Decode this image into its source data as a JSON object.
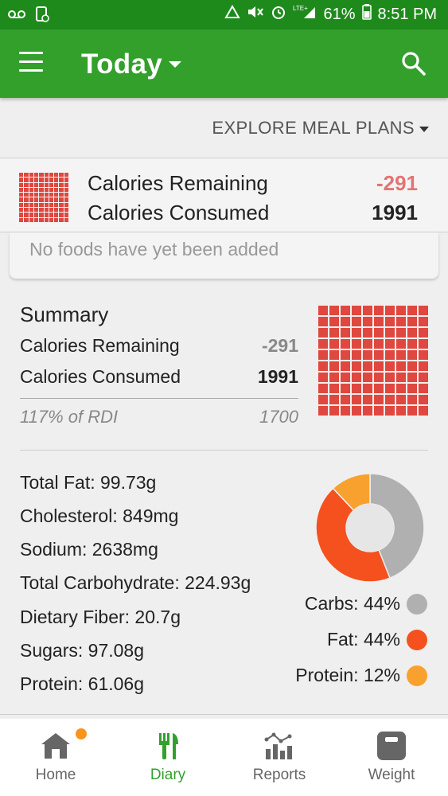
{
  "status_bar": {
    "battery": "61%",
    "time": "8:51 PM",
    "network": "LTE+"
  },
  "app_bar": {
    "title": "Today"
  },
  "explore": {
    "label": "EXPLORE MEAL PLANS"
  },
  "calorie_card": {
    "remaining_label": "Calories Remaining",
    "remaining_value": "-291",
    "consumed_label": "Calories Consumed",
    "consumed_value": "1991",
    "empty_message": "No foods have yet been added"
  },
  "summary": {
    "title": "Summary",
    "remaining_label": "Calories Remaining",
    "remaining_value": "-291",
    "consumed_label": "Calories Consumed",
    "consumed_value": "1991",
    "rdi_label": "117% of RDI",
    "rdi_value": "1700"
  },
  "nutrients": [
    "Total Fat: 99.73g",
    "Cholesterol: 849mg",
    "Sodium: 2638mg",
    "Total Carbohydrate: 224.93g",
    "Dietary Fiber: 20.7g",
    "Sugars: 97.08g",
    "Protein: 61.06g"
  ],
  "macros": {
    "legend": [
      {
        "label": "Carbs: 44%",
        "color": "#b0b0b0"
      },
      {
        "label": "Fat: 44%",
        "color": "#f4511e"
      },
      {
        "label": "Protein: 12%",
        "color": "#f9a12e"
      }
    ]
  },
  "chart_data": {
    "type": "pie",
    "categories": [
      "Carbs",
      "Fat",
      "Protein"
    ],
    "values": [
      44,
      44,
      12
    ],
    "colors": [
      "#b0b0b0",
      "#f4511e",
      "#f9a12e"
    ],
    "title": "",
    "donut": true
  },
  "bottom_nav": {
    "items": [
      {
        "label": "Home",
        "icon": "home-icon"
      },
      {
        "label": "Diary",
        "icon": "diary-icon"
      },
      {
        "label": "Reports",
        "icon": "reports-icon"
      },
      {
        "label": "Weight",
        "icon": "weight-icon"
      }
    ],
    "active": "Diary"
  },
  "colors": {
    "brand_green": "#33a02c",
    "status_green": "#1f8a1c",
    "grid_red": "#e0473e",
    "negative": "#e57373",
    "notification": "#f7941d"
  }
}
